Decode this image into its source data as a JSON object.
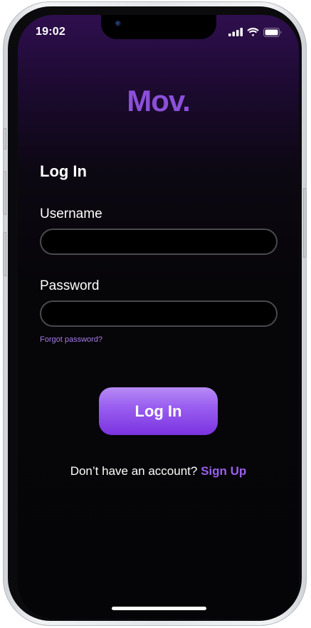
{
  "status_bar": {
    "time": "19:02",
    "icons": [
      "signal-icon",
      "wifi-icon",
      "battery-icon"
    ]
  },
  "logo": {
    "text": "Mov."
  },
  "form": {
    "title": "Log In",
    "username_label": "Username",
    "username_value": "",
    "password_label": "Password",
    "password_value": "",
    "forgot_password": "Forgot password?",
    "submit_label": "Log In"
  },
  "signup": {
    "prompt": "Don’t have an account?",
    "link_label": "Sign Up"
  },
  "colors": {
    "accent": "#9a5ff0",
    "logo": "#8b4fd9",
    "link": "#a67ce8",
    "background_top": "#2f0f4e",
    "background_bottom": "#050507",
    "input_border": "#4a4a4e"
  }
}
